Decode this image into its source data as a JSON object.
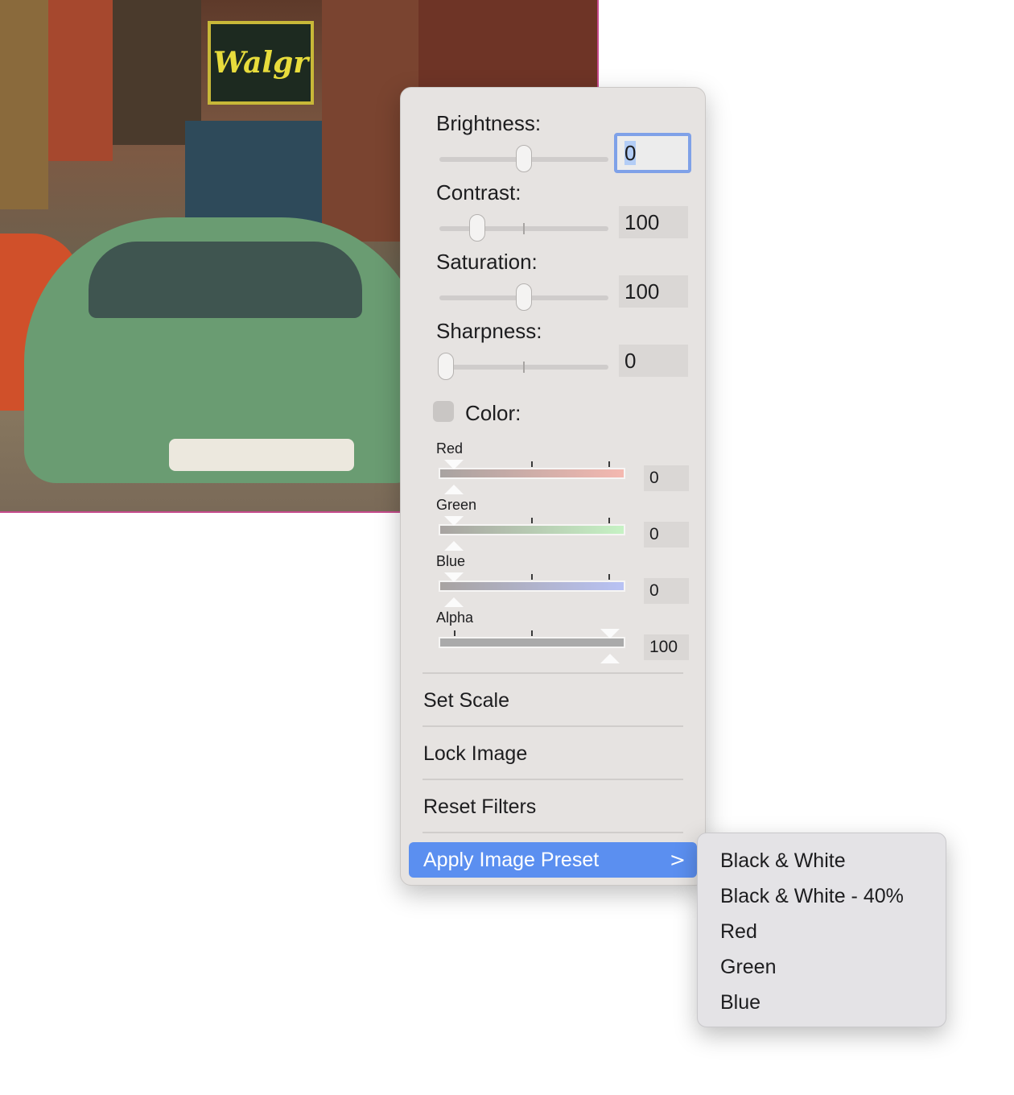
{
  "adjustments": {
    "brightness": {
      "label": "Brightness:",
      "value": "0",
      "level": 0.5
    },
    "contrast": {
      "label": "Contrast:",
      "value": "100",
      "level": 0.22
    },
    "saturation": {
      "label": "Saturation:",
      "value": "100",
      "level": 0.5
    },
    "sharpness": {
      "label": "Sharpness:",
      "value": "0",
      "level": 0.0
    }
  },
  "color": {
    "label": "Color:",
    "checked": false,
    "channels": [
      {
        "name": "Red",
        "value": "0",
        "color": "#f4b8b0"
      },
      {
        "name": "Green",
        "value": "0",
        "color": "#c6f2c4"
      },
      {
        "name": "Blue",
        "value": "0",
        "color": "#b8c2f4"
      },
      {
        "name": "Alpha",
        "value": "100",
        "color": "#aaaaaa"
      }
    ]
  },
  "menu": {
    "set_scale": "Set Scale",
    "lock_image": "Lock Image",
    "reset_filters": "Reset Filters",
    "apply_preset": "Apply Image Preset",
    "apply_preset_chevron": ">"
  },
  "submenu": {
    "items": [
      "Black & White",
      "Black & White - 40%",
      "Red",
      "Green",
      "Blue"
    ]
  },
  "photo": {
    "sign_text": "Walgr"
  }
}
